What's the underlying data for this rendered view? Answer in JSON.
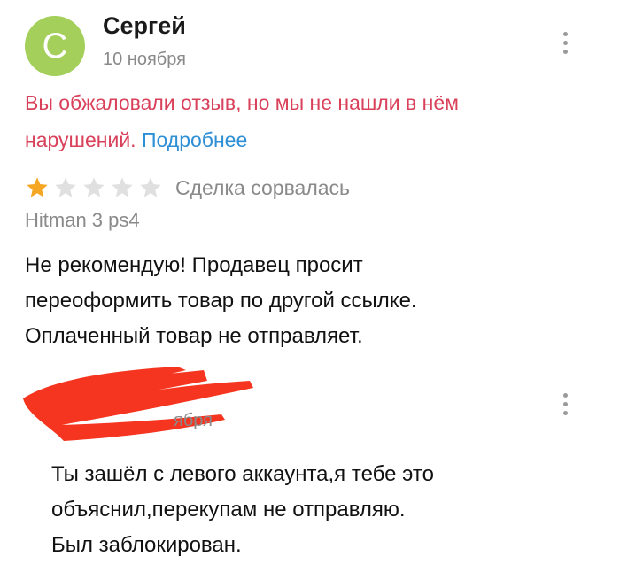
{
  "review": {
    "avatar_letter": "С",
    "avatar_color": "#a3cf5a",
    "author": "Сергей",
    "date": "10 ноября",
    "notice_text": "Вы обжаловали отзыв, но мы не нашли в нём нарушений.",
    "notice_link": "Подробнее",
    "notice_color": "#d9405a",
    "link_color": "#2d8fd5",
    "rating": 1,
    "rating_max": 5,
    "rating_label": "Сделка сорвалась",
    "product": "Hitman 3 ps4",
    "text_lines": [
      "Не рекомендую!  Продавец просит",
      "переоформить товар по другой ссылке.",
      "Оплаченный товар не отправляет."
    ]
  },
  "reply": {
    "date_partial": "ября",
    "redaction_color": "#f5351f",
    "text_lines": [
      "Ты зашёл с левого аккаунта,я тебе это",
      "объяснил,перекупам не отправляю.",
      "Был заблокирован."
    ]
  },
  "icons": {
    "menu": "more-vertical-icon",
    "star_filled_color": "#f5a623",
    "star_empty_color": "#e0e0e0"
  }
}
